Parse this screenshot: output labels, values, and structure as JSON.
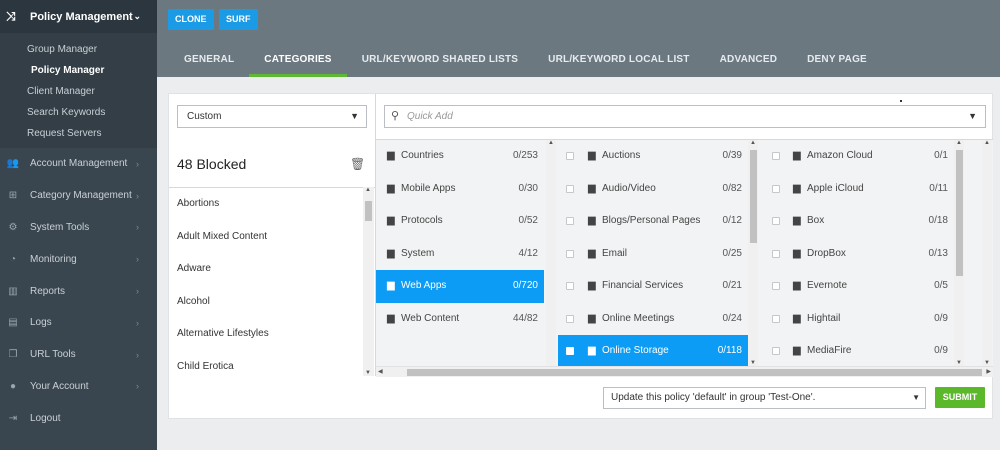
{
  "sidebar": {
    "header": {
      "label": "Policy Management",
      "icon": "shuffle-icon"
    },
    "submenu": [
      {
        "label": "Group Manager",
        "active": false
      },
      {
        "label": "Policy Manager",
        "active": true
      },
      {
        "label": "Client Manager",
        "active": false
      },
      {
        "label": "Search Keywords",
        "active": false
      },
      {
        "label": "Request Servers",
        "active": false
      }
    ],
    "items": [
      {
        "label": "Account Management",
        "icon": "users-icon",
        "chevron": true
      },
      {
        "label": "Category Management",
        "icon": "sitemap-icon",
        "chevron": true
      },
      {
        "label": "System Tools",
        "icon": "cogs-icon",
        "chevron": true
      },
      {
        "label": "Monitoring",
        "icon": "dashboard-icon",
        "chevron": true
      },
      {
        "label": "Reports",
        "icon": "bar-chart-icon",
        "chevron": true
      },
      {
        "label": "Logs",
        "icon": "file-icon",
        "chevron": true
      },
      {
        "label": "URL Tools",
        "icon": "copy-icon",
        "chevron": true
      },
      {
        "label": "Your Account",
        "icon": "user-icon",
        "chevron": true
      },
      {
        "label": "Logout",
        "icon": "logout-icon",
        "chevron": false
      }
    ]
  },
  "toolbar": {
    "clone_label": "CLONE",
    "surf_label": "SURF"
  },
  "tabs": [
    {
      "label": "GENERAL",
      "active": false
    },
    {
      "label": "CATEGORIES",
      "active": true
    },
    {
      "label": "URL/KEYWORD SHARED LISTS",
      "active": false
    },
    {
      "label": "URL/KEYWORD LOCAL LIST",
      "active": false
    },
    {
      "label": "ADVANCED",
      "active": false
    },
    {
      "label": "DENY PAGE",
      "active": false
    }
  ],
  "left": {
    "preset_value": "Custom",
    "blocked_title": "48 Blocked",
    "blocked_items": [
      "Abortions",
      "Adult Mixed Content",
      "Adware",
      "Alcohol",
      "Alternative Lifestyles",
      "Child Erotica"
    ]
  },
  "quick_add": {
    "placeholder": "Quick Add"
  },
  "groups": [
    {
      "label": "Countries",
      "count": "0/253",
      "selected": false
    },
    {
      "label": "Mobile Apps",
      "count": "0/30",
      "selected": false
    },
    {
      "label": "Protocols",
      "count": "0/52",
      "selected": false
    },
    {
      "label": "System",
      "count": "4/12",
      "selected": false
    },
    {
      "label": "Web Apps",
      "count": "0/720",
      "selected": true
    },
    {
      "label": "Web Content",
      "count": "44/82",
      "selected": false
    }
  ],
  "subgroups": [
    {
      "label": "Auctions",
      "count": "0/39",
      "selected": false
    },
    {
      "label": "Audio/Video",
      "count": "0/82",
      "selected": false
    },
    {
      "label": "Blogs/Personal Pages",
      "count": "0/12",
      "selected": false
    },
    {
      "label": "Email",
      "count": "0/25",
      "selected": false
    },
    {
      "label": "Financial Services",
      "count": "0/21",
      "selected": false
    },
    {
      "label": "Online Meetings",
      "count": "0/24",
      "selected": false
    },
    {
      "label": "Online Storage",
      "count": "0/118",
      "selected": true
    }
  ],
  "apps": [
    {
      "label": "Amazon Cloud",
      "count": "0/1"
    },
    {
      "label": "Apple iCloud",
      "count": "0/11"
    },
    {
      "label": "Box",
      "count": "0/18"
    },
    {
      "label": "DropBox",
      "count": "0/13"
    },
    {
      "label": "Evernote",
      "count": "0/5"
    },
    {
      "label": "Hightail",
      "count": "0/9"
    },
    {
      "label": "MediaFire",
      "count": "0/9"
    }
  ],
  "footer": {
    "update_value": "Update this policy 'default' in group 'Test-One'.",
    "submit_label": "SUBMIT"
  },
  "colors": {
    "sidebar_bg": "#3a464f",
    "topbar_bg": "#6b7880",
    "accent_blue": "#0d9cf5",
    "submit_green": "#5cb82b",
    "active_tab_underline": "#5fb833"
  }
}
